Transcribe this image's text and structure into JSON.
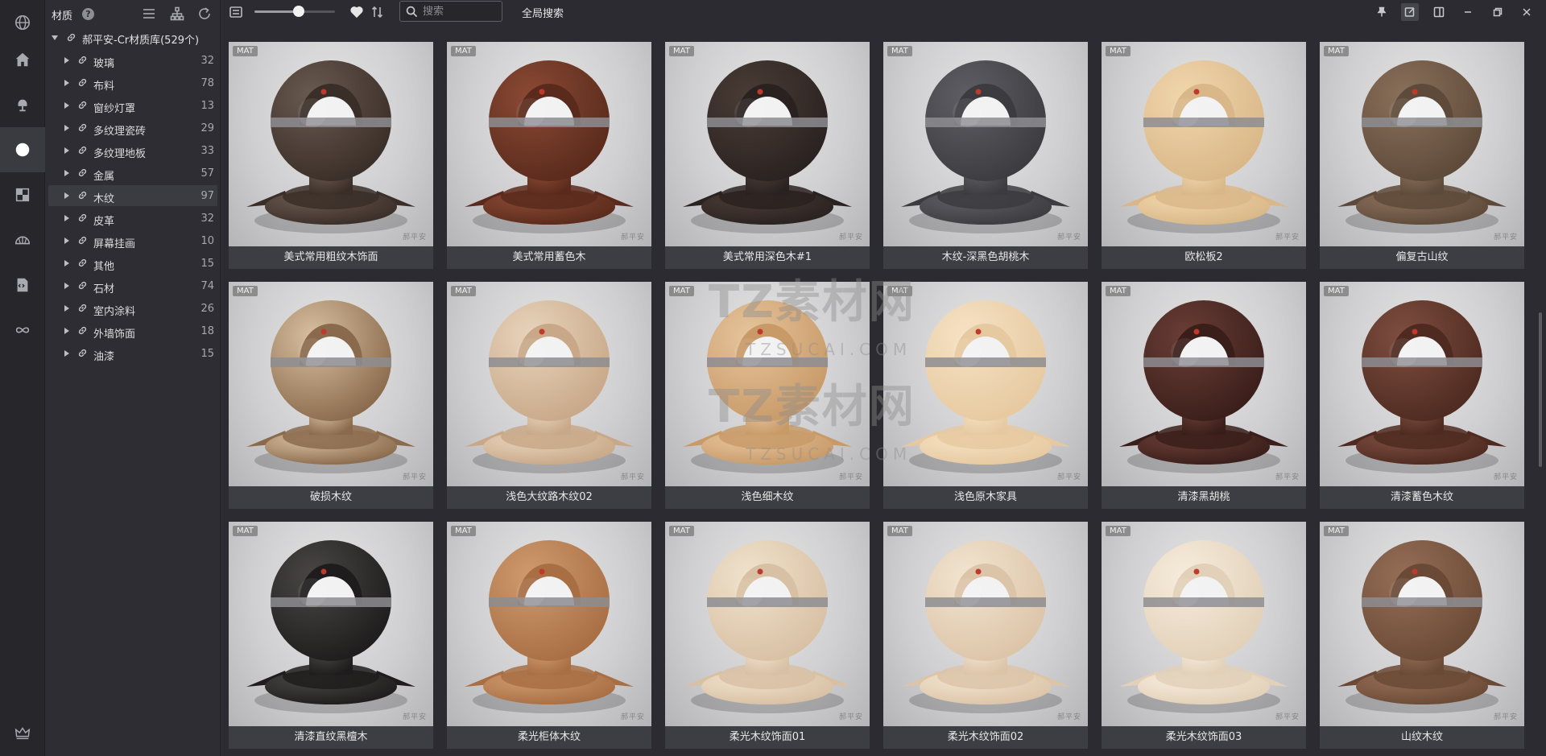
{
  "sidebar": {
    "title": "材质",
    "help": "?",
    "root": {
      "label": "郝平安-Cr材质库(529个)"
    },
    "items": [
      {
        "label": "玻璃",
        "count": "32"
      },
      {
        "label": "布料",
        "count": "78"
      },
      {
        "label": "窗纱灯罩",
        "count": "13"
      },
      {
        "label": "多纹理瓷砖",
        "count": "29"
      },
      {
        "label": "多纹理地板",
        "count": "33"
      },
      {
        "label": "金属",
        "count": "57"
      },
      {
        "label": "木纹",
        "count": "97"
      },
      {
        "label": "皮革",
        "count": "32"
      },
      {
        "label": "屏幕挂画",
        "count": "10"
      },
      {
        "label": "其他",
        "count": "15"
      },
      {
        "label": "石材",
        "count": "74"
      },
      {
        "label": "室内涂料",
        "count": "26"
      },
      {
        "label": "外墙饰面",
        "count": "18"
      },
      {
        "label": "油漆",
        "count": "15"
      }
    ],
    "selected_index": 6
  },
  "rail": {
    "icons": [
      "globe-icon",
      "home-icon",
      "lamp-icon",
      "sphere-icon",
      "texture-icon",
      "dome-icon",
      "script-icon",
      "infinity-icon",
      "crown-icon"
    ],
    "active": "sphere-icon"
  },
  "toolbar": {
    "zoom_level": 0.55,
    "search_placeholder": "搜索",
    "global_search": "全局搜索"
  },
  "grid": {
    "badge": "MAT",
    "watermark": "郝平安",
    "items": [
      {
        "name": "美式常用粗纹木饰面",
        "base": "#3a2e28",
        "light": "#6a5a50"
      },
      {
        "name": "美式常用蓄色木",
        "base": "#5a2a1c",
        "light": "#8a4a34"
      },
      {
        "name": "美式常用深色木#1",
        "base": "#2a2220",
        "light": "#4a3c36"
      },
      {
        "name": "木纹-深黑色胡桃木",
        "base": "#3c3c40",
        "light": "#5e5e64"
      },
      {
        "name": "欧松板2",
        "base": "#d9b788",
        "light": "#f1d6ac"
      },
      {
        "name": "偏复古山纹",
        "base": "#5e4a3a",
        "light": "#8a705a"
      },
      {
        "name": "破损木纹",
        "base": "#8a6a4c",
        "light": "#d8c0a0"
      },
      {
        "name": "浅色大纹路木纹02",
        "base": "#c8a888",
        "light": "#e8d4bc"
      },
      {
        "name": "浅色细木纹",
        "base": "#c89a68",
        "light": "#e6c49c"
      },
      {
        "name": "浅色原木家具",
        "base": "#e6c9a0",
        "light": "#f6e2c4"
      },
      {
        "name": "清漆黑胡桃",
        "base": "#3a1e1a",
        "light": "#6a3e36"
      },
      {
        "name": "清漆蓄色木纹",
        "base": "#4e2a20",
        "light": "#7e4e40"
      },
      {
        "name": "清漆直纹黑檀木",
        "base": "#1e1c1c",
        "light": "#4a4646"
      },
      {
        "name": "柔光柜体木纹",
        "base": "#a86e44",
        "light": "#d09a6e"
      },
      {
        "name": "柔光木纹饰面01",
        "base": "#d8c0a4",
        "light": "#f0e2cc"
      },
      {
        "name": "柔光木纹饰面02",
        "base": "#dcc4a8",
        "light": "#f2e4d0"
      },
      {
        "name": "柔光木纹饰面03",
        "base": "#e2d0b8",
        "light": "#f6ecdc"
      },
      {
        "name": "山纹木纹",
        "base": "#6a4a36",
        "light": "#966e56"
      }
    ]
  },
  "overlay_watermark": {
    "big": "TZ素材网",
    "small": "TZSUCAI.COM"
  }
}
